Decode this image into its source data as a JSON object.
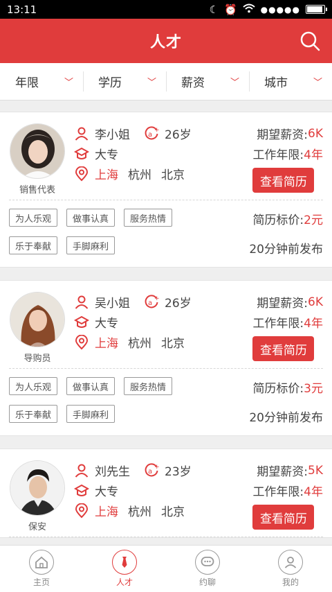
{
  "status": {
    "time": "13:11"
  },
  "header": {
    "title": "人才"
  },
  "filters": [
    {
      "label": "年限"
    },
    {
      "label": "学历"
    },
    {
      "label": "薪资"
    },
    {
      "label": "城市"
    }
  ],
  "labels": {
    "expected_salary": "期望薪资:",
    "work_years": "工作年限:",
    "view_resume": "查看简历",
    "resume_price": "简历标价:"
  },
  "candidates": [
    {
      "name": "李小姐",
      "age": "26岁",
      "job": "销售代表",
      "education": "大专",
      "city_current": "上海",
      "city_2": "杭州",
      "city_3": "北京",
      "salary": "6K",
      "years": "4年",
      "price": "2元",
      "posted": "20分钟前发布",
      "tags": [
        "为人乐观",
        "做事认真",
        "服务热情",
        "乐于奉献",
        "手脚麻利"
      ]
    },
    {
      "name": "吴小姐",
      "age": "26岁",
      "job": "导购员",
      "education": "大专",
      "city_current": "上海",
      "city_2": "杭州",
      "city_3": "北京",
      "salary": "6K",
      "years": "4年",
      "price": "3元",
      "posted": "20分钟前发布",
      "tags": [
        "为人乐观",
        "做事认真",
        "服务热情",
        "乐于奉献",
        "手脚麻利"
      ]
    },
    {
      "name": "刘先生",
      "age": "23岁",
      "job": "保安",
      "education": "大专",
      "city_current": "上海",
      "city_2": "杭州",
      "city_3": "北京",
      "salary": "5K",
      "years": "4年"
    }
  ],
  "nav": [
    {
      "label": "主页",
      "icon": "home-icon"
    },
    {
      "label": "人才",
      "icon": "tie-icon"
    },
    {
      "label": "约聊",
      "icon": "chat-icon"
    },
    {
      "label": "我的",
      "icon": "user-icon"
    }
  ],
  "colors": {
    "accent": "#e03c3c"
  }
}
